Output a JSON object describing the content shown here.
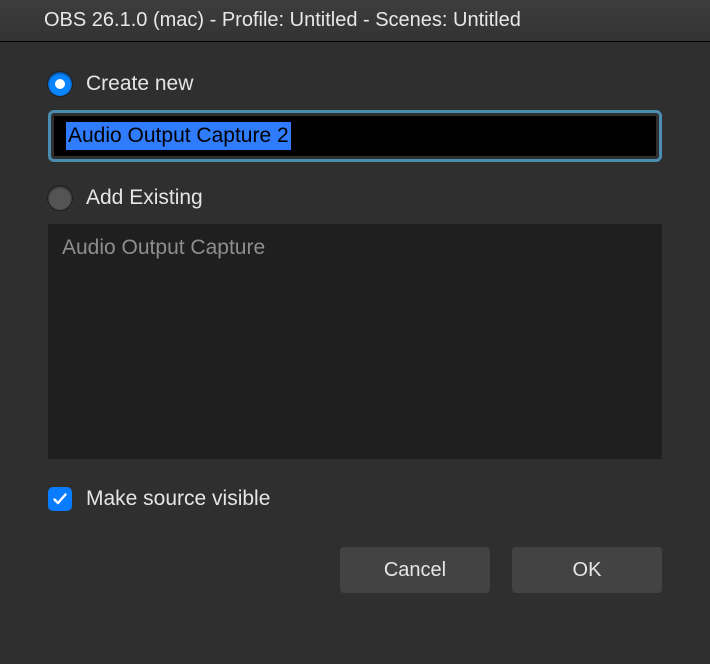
{
  "titlebar": {
    "text": "OBS 26.1.0 (mac) - Profile: Untitled - Scenes: Untitled"
  },
  "dialog": {
    "create_new_label": "Create new",
    "name_input_value": "Audio Output Capture 2",
    "add_existing_label": "Add Existing",
    "existing_items": [
      "Audio Output Capture"
    ],
    "make_visible_label": "Make source visible",
    "cancel_label": "Cancel",
    "ok_label": "OK"
  }
}
